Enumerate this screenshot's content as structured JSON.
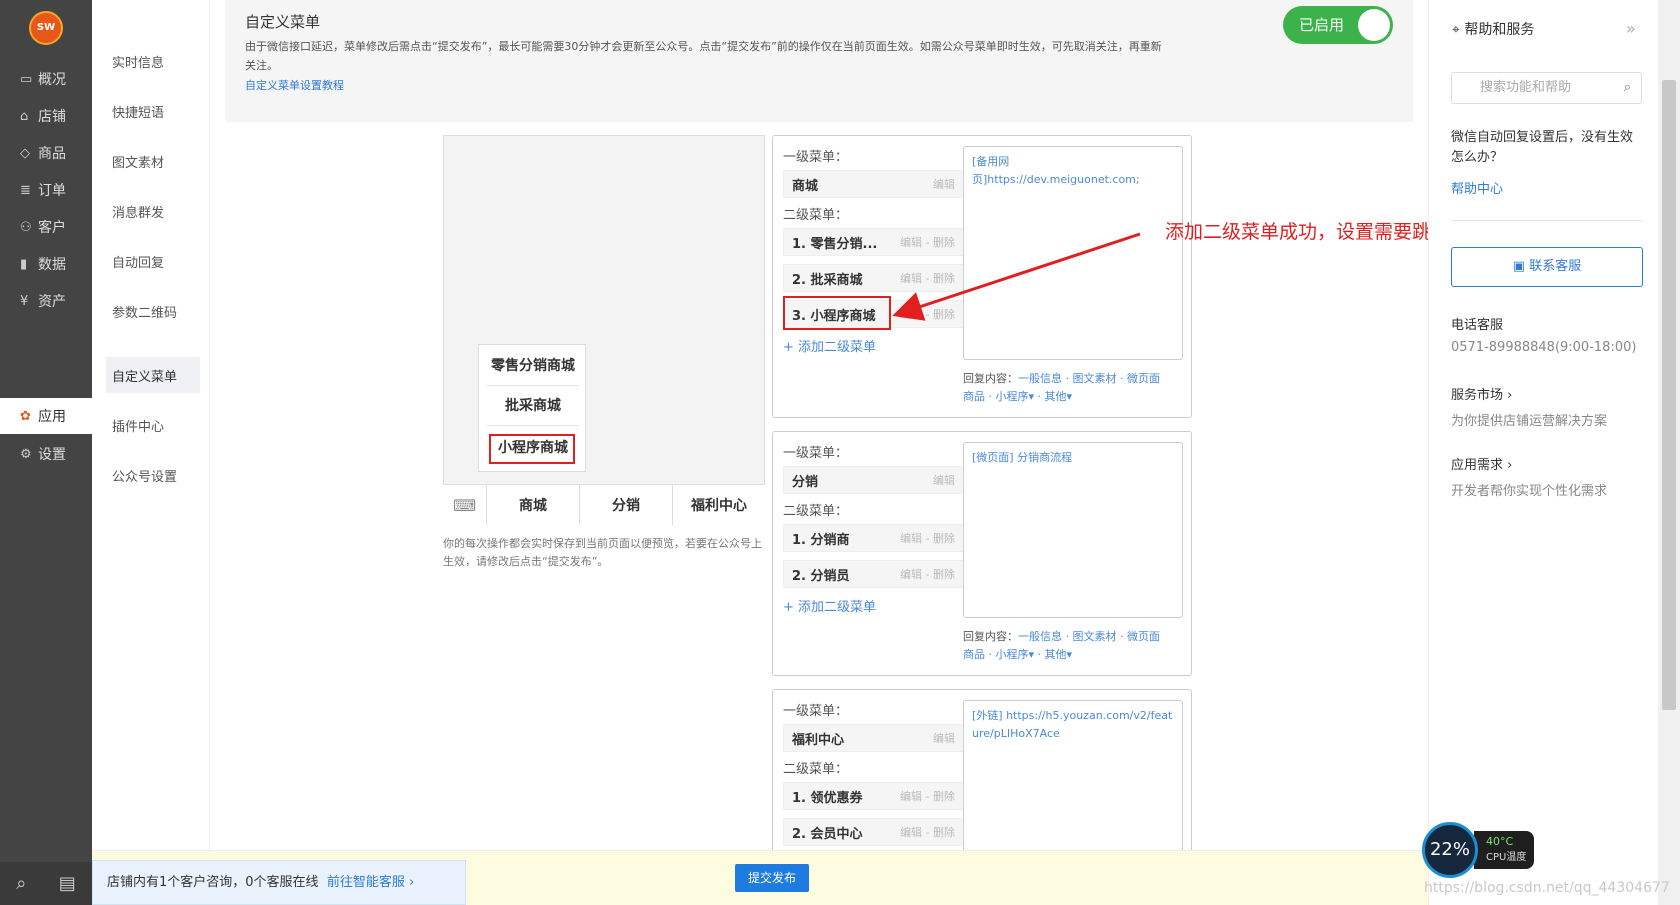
{
  "leftnav": {
    "logo_text": "SW",
    "items": [
      {
        "label": "概况",
        "icon": "monitor-icon"
      },
      {
        "label": "店铺",
        "icon": "store-icon"
      },
      {
        "label": "商品",
        "icon": "tag-icon"
      },
      {
        "label": "订单",
        "icon": "order-icon"
      },
      {
        "label": "客户",
        "icon": "user-icon"
      },
      {
        "label": "数据",
        "icon": "chart-icon"
      },
      {
        "label": "资产",
        "icon": "yen-icon"
      },
      {
        "label": "应用",
        "icon": "apps-icon"
      },
      {
        "label": "设置",
        "icon": "gear-icon"
      }
    ]
  },
  "subnav": {
    "items": [
      "实时信息",
      "快捷短语",
      "图文素材",
      "消息群发",
      "自动回复",
      "参数二维码",
      "自定义菜单",
      "插件中心",
      "公众号设置"
    ]
  },
  "header": {
    "title": "自定义菜单",
    "desc": "由于微信接口延迟，菜单修改后需点击“提交发布”，最长可能需要30分钟才会更新至公众号。点击“提交发布”前的操作仅在当前页面生效。如需公众号菜单即时生效，可先取消关注，再重新关注。",
    "tutorial_link": "自定义菜单设置教程",
    "toggle_label": "已启用"
  },
  "preview": {
    "popup_items": [
      "零售分销商城",
      "批采商城",
      "小程序商城"
    ],
    "tabs": [
      "商城",
      "分销",
      "福利中心"
    ],
    "note": "你的每次操作都会实时保存到当前页面以便预览，若要在公众号上生效，请修改后点击“提交发布”。"
  },
  "labels": {
    "level1": "一级菜单：",
    "level2": "二级菜单：",
    "edit": "编辑",
    "edit_delete": "编辑 - 删除",
    "add_sub": "+ 添加二级菜单",
    "reply_prefix": "回复内容：",
    "reply_links_1": "一般信息 · 图文素材 · 微页面",
    "reply_links_2": "商品 · 小程序▾ · 其他▾"
  },
  "menus": [
    {
      "level1": "商城",
      "subs": [
        "1. 零售分销...",
        "2. 批采商城",
        "3. 小程序商城"
      ],
      "content": "[备用网页]https://dev.meiguonet.com;"
    },
    {
      "level1": "分销",
      "subs": [
        "1. 分销商",
        "2. 分销员"
      ],
      "content": "[微页面] 分销商流程"
    },
    {
      "level1": "福利中心",
      "subs": [
        "1. 领优惠券",
        "2. 会员中心"
      ],
      "content": "[外链] https://h5.youzan.com/v2/feature/pLIHoX7Ace"
    }
  ],
  "annotation": "添加二级菜单成功，设置需要跳转的小程序",
  "rightpanel": {
    "title": "帮助和服务",
    "search_placeholder": "搜索功能和帮助",
    "question": "微信自动回复设置后，没有生效怎么办？",
    "help_link": "帮助中心",
    "contact_button": "联系客服",
    "phone_title": "电话客服",
    "phone": "0571-89988848(9:00-18:00)",
    "market_title": "服务市场 ›",
    "market_desc": "为你提供店铺运营解决方案",
    "app_title": "应用需求 ›",
    "app_desc": "开发者帮你实现个性化需求"
  },
  "bottom": {
    "cs_tip": "店铺内有1个客户咨询，0个客服在线",
    "cs_link": "前往智能客服 ›",
    "publish": "提交发布"
  },
  "cpu": {
    "percent": "22%",
    "temp": "40°C",
    "label": "CPU温度"
  },
  "watermark": "https://blog.csdn.net/qq_44304677",
  "colors": {
    "accent": "#2f7bd6",
    "enabled": "#3bb34a",
    "highlight": "#e02020",
    "sidebar": "#444444"
  }
}
